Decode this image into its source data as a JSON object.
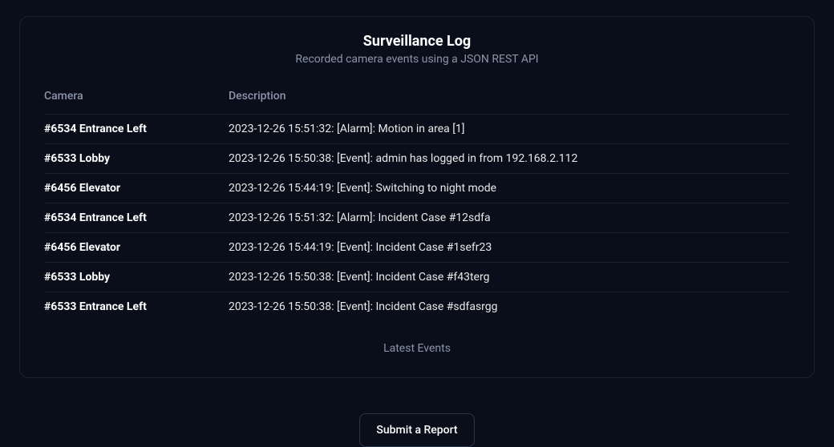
{
  "card": {
    "title": "Surveillance Log",
    "subtitle": "Recorded camera events using a JSON REST API",
    "caption": "Latest Events"
  },
  "table": {
    "headers": {
      "camera": "Camera",
      "description": "Description"
    },
    "rows": [
      {
        "camera": "#6534 Entrance Left",
        "description": "2023-12-26 15:51:32: [Alarm]: Motion in area [1]"
      },
      {
        "camera": "#6533 Lobby",
        "description": "2023-12-26 15:50:38: [Event]: admin has logged in from 192.168.2.112"
      },
      {
        "camera": "#6456 Elevator",
        "description": "2023-12-26 15:44:19: [Event]: Switching to night mode"
      },
      {
        "camera": "#6534 Entrance Left",
        "description": "2023-12-26 15:51:32: [Alarm]: Incident Case #12sdfa"
      },
      {
        "camera": "#6456 Elevator",
        "description": "2023-12-26 15:44:19: [Event]: Incident Case #1sefr23"
      },
      {
        "camera": "#6533 Lobby",
        "description": "2023-12-26 15:50:38: [Event]: Incident Case #f43terg"
      },
      {
        "camera": "#6533 Entrance Left",
        "description": "2023-12-26 15:50:38: [Event]: Incident Case #sdfasrgg"
      }
    ]
  },
  "button": {
    "submit_label": "Submit a Report"
  }
}
